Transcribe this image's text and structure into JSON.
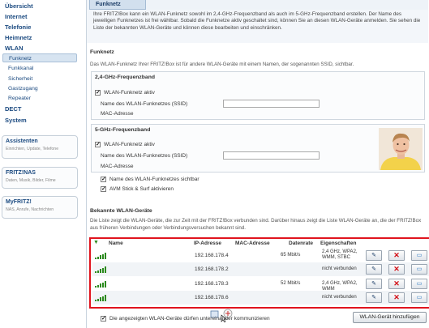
{
  "sidebar": {
    "main_items": [
      {
        "label": "Übersicht"
      },
      {
        "label": "Internet"
      },
      {
        "label": "Telefonie"
      },
      {
        "label": "Heimnetz"
      },
      {
        "label": "WLAN"
      }
    ],
    "wlan_sub": [
      {
        "label": "Funknetz"
      },
      {
        "label": "Funkkanal"
      },
      {
        "label": "Sicherheit"
      },
      {
        "label": "Gastzugang"
      },
      {
        "label": "Repeater"
      }
    ],
    "more_items": [
      {
        "label": "DECT"
      },
      {
        "label": "System"
      }
    ],
    "boxes": [
      {
        "title": "Assistenten",
        "sub": "Einrichten, Update, Telefone"
      },
      {
        "title": "FRITZ!NAS",
        "sub": "Daten, Musik, Bilder, Filme"
      },
      {
        "title": "MyFRITZ!",
        "sub": "NAS, Anrufe, Nachrichten"
      }
    ]
  },
  "tab": {
    "label": "Funknetz"
  },
  "intro": "Ihre FRITZ!Box kann ein WLAN-Funknetz sowohl im 2,4-GHz-Frequenzband als auch im 5-GHz-Frequenzband erstellen. Der Name des jeweiligen Funknetzes ist frei wählbar. Sobald die Funknetze aktiv geschaltet sind, können Sie an diesen WLAN-Geräte anmelden. Sie sehen die Liste der bekannten WLAN-Geräte und können diese bearbeiten und einschränken.",
  "funknetz": {
    "heading": "Funknetz",
    "desc": "Das WLAN-Funknetz Ihrer FRITZ!Box ist für andere WLAN-Geräte mit einem Namen, der sogenannten SSID, sichtbar.",
    "band24": {
      "heading": "2,4-GHz-Frequenzband",
      "active_label": "WLAN-Funknetz aktiv",
      "ssid_label": "Name des WLAN-Funknetzes (SSID)",
      "mac_label": "MAC-Adresse",
      "ssid_value": ""
    },
    "band5": {
      "heading": "5-GHz-Frequenzband",
      "active_label": "WLAN-Funknetz aktiv",
      "ssid_label": "Name des WLAN-Funknetzes (SSID)",
      "mac_label": "MAC-Adresse",
      "ssid_value": ""
    },
    "visible_label": "Name des WLAN-Funknetzes sichtbar",
    "avm_label": "AVM Stick & Surf aktivieren"
  },
  "devices": {
    "heading": "Bekannte WLAN-Geräte",
    "desc": "Die Liste zeigt die WLAN-Geräte, die zur Zeit mit der FRITZ!Box verbunden sind. Darüber hinaus zeigt die Liste WLAN-Geräte an, die der FRITZ!Box aus früheren Verbindungen oder Verbindungsversuchen bekannt sind.",
    "columns": {
      "name": "Name",
      "ip": "IP-Adresse",
      "mac": "MAC-Adresse",
      "rate": "Datenrate",
      "props": "Eigenschaften"
    },
    "rows": [
      {
        "ip": "192.168.178.4",
        "rate": "65 Mbit/s",
        "props": "2,4 GHz, WPA2, WMM, STBC",
        "signal": 5
      },
      {
        "ip": "192.168.178.2",
        "rate": "",
        "props": "nicht verbunden",
        "signal": 5
      },
      {
        "ip": "192.168.178.3",
        "rate": "52 Mbit/s",
        "props": "2,4 GHz, WPA2, WMM",
        "signal": 5
      },
      {
        "ip": "192.168.178.6",
        "rate": "",
        "props": "nicht verbunden",
        "signal": 5
      }
    ],
    "allow_label": "Die angezeigten WLAN-Geräte dürfen untereinander kommunizieren",
    "add_button": "WLAN-Gerät hinzufügen"
  },
  "colors": {
    "accent": "#1b4a80",
    "highlight": "#e0141e",
    "signal": "#2c8a1e"
  }
}
